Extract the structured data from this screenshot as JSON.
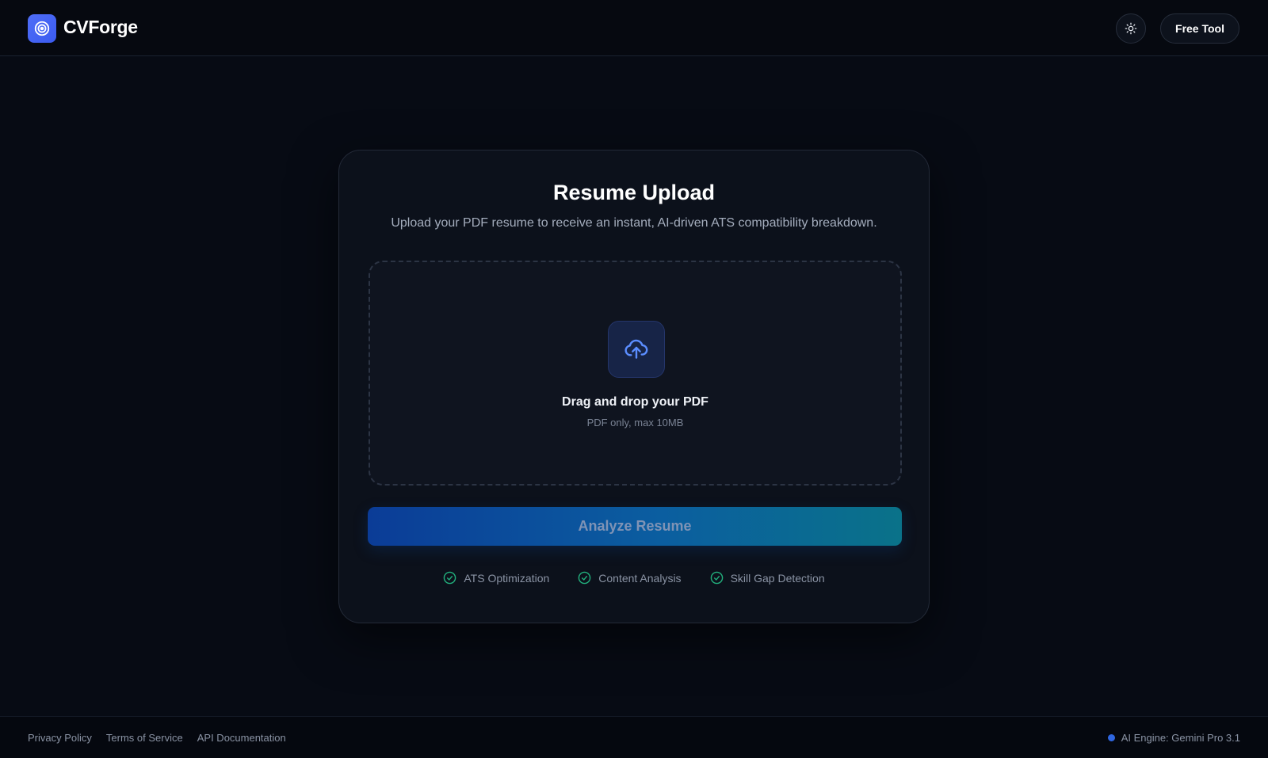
{
  "app": {
    "brand": "CVForge",
    "logo_icon": "target-icon",
    "accent_color": "#4f6ef7"
  },
  "header": {
    "theme_toggle_icon": "sun-icon",
    "free_tool_label": "Free Tool"
  },
  "upload_card": {
    "title": "Resume Upload",
    "subtitle": "Upload your PDF resume to receive an instant, AI-driven ATS compatibility breakdown.",
    "dropzone": {
      "icon": "cloud-upload-icon",
      "title": "Drag and drop your PDF",
      "hint": "PDF only, max 10MB"
    },
    "analyze_button_label": "Analyze Resume",
    "features": [
      {
        "label": "ATS Optimization",
        "icon": "check-circle-icon"
      },
      {
        "label": "Content Analysis",
        "icon": "check-circle-icon"
      },
      {
        "label": "Skill Gap Detection",
        "icon": "check-circle-icon"
      }
    ],
    "feature_check_color": "#22b07d"
  },
  "footer": {
    "links": [
      "Privacy Policy",
      "Terms of Service",
      "API Documentation"
    ],
    "engine_status": "AI Engine: Gemini Pro 3.1",
    "engine_dot_color": "#2f66e0"
  }
}
